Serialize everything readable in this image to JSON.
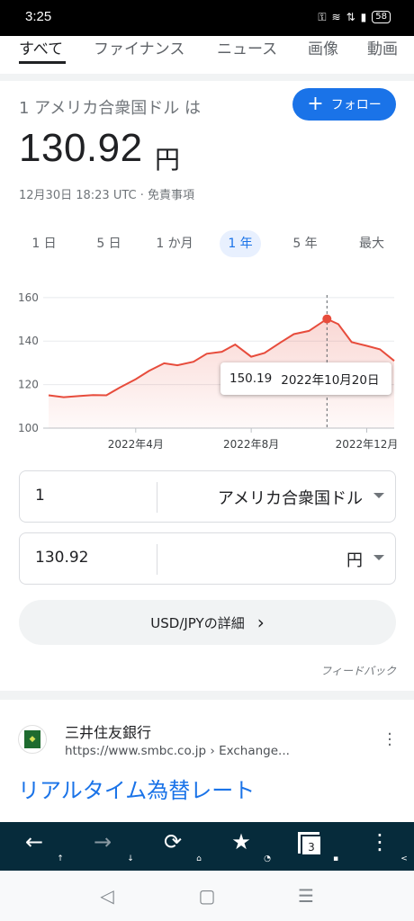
{
  "status_bar": {
    "time": "3:25",
    "icons": [
      "vpn-icon",
      "wifi-icon",
      "lte-icon",
      "signal-icon"
    ],
    "battery": "58"
  },
  "tabs": [
    {
      "label": "すべて",
      "active": true
    },
    {
      "label": "ファイナンス",
      "active": false
    },
    {
      "label": "ニュース",
      "active": false
    },
    {
      "label": "画像",
      "active": false
    },
    {
      "label": "動画",
      "active": false
    }
  ],
  "finance": {
    "heading": "1 アメリカ合衆国ドル は",
    "follow_label": "フォロー",
    "price": "130.92",
    "price_unit": "円",
    "timestamp": "12月30日 18:23 UTC · 免責事項",
    "ranges": [
      "1 日",
      "5 日",
      "1 か月",
      "1 年",
      "5 年",
      "最大"
    ],
    "active_range": "1 年"
  },
  "chart_data": {
    "type": "area",
    "series": [
      {
        "x": [
          "2021-12-30",
          "2022-01-15",
          "2022-02-01",
          "2022-02-15",
          "2022-03-01",
          "2022-03-15",
          "2022-04-01",
          "2022-04-15",
          "2022-05-01",
          "2022-05-15",
          "2022-06-01",
          "2022-06-15",
          "2022-07-01",
          "2022-07-15",
          "2022-08-01",
          "2022-08-15",
          "2022-09-01",
          "2022-09-15",
          "2022-10-01",
          "2022-10-20",
          "2022-11-01",
          "2022-11-15",
          "2022-12-01",
          "2022-12-15",
          "2022-12-30"
        ],
        "values": [
          115.1,
          114.2,
          114.8,
          115.2,
          115.1,
          118.6,
          122.5,
          126.3,
          129.8,
          128.9,
          130.5,
          134.2,
          135.1,
          138.4,
          132.8,
          134.5,
          139.4,
          143.2,
          144.7,
          150.19,
          147.8,
          139.5,
          137.8,
          136.2,
          130.92
        ]
      }
    ],
    "x_ticks": [
      "2022年4月",
      "2022年8月",
      "2022年12月"
    ],
    "y_ticks": [
      100,
      120,
      140,
      160
    ],
    "ylim": [
      100,
      162
    ],
    "grid": true,
    "line_color": "#e74c3c",
    "highlight": {
      "value": "150.19",
      "date": "2022年10月20日"
    }
  },
  "converter": {
    "from_value": "1",
    "from_currency": "アメリカ合衆国ドル",
    "to_value": "130.92",
    "to_currency": "円"
  },
  "details_label": "USD/JPYの詳細",
  "feedback_label": "フィードバック",
  "result": {
    "site_name": "三井住友銀行",
    "url": "https://www.smbc.co.jp › Exchange...",
    "title": "リアルタイム為替レート"
  },
  "toolbar": {
    "tab_count": "3"
  },
  "colors": {
    "accent": "#1a73e8",
    "chart_line": "#e74c3c",
    "toolbar_bg": "#062b3b"
  }
}
